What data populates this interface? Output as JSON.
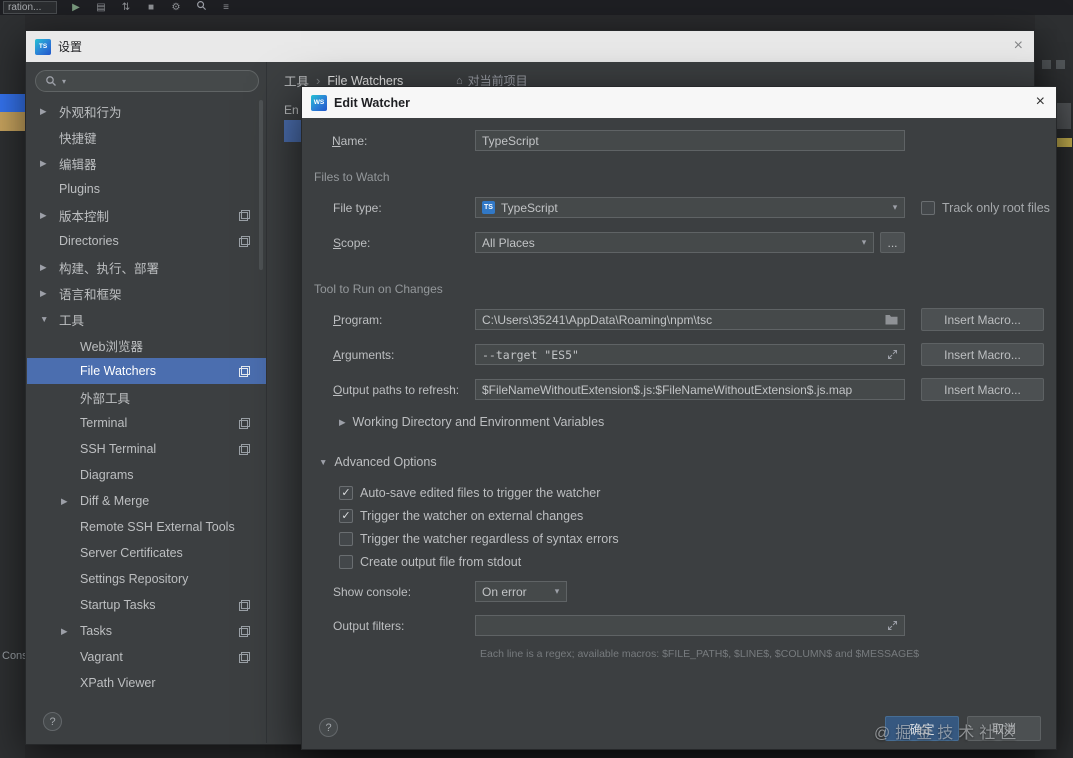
{
  "watermark_text": "@掘金技术社区",
  "colors": {
    "selection_blue": "#4b6eaf",
    "ok_button_blue": "#365880",
    "left_strip_blue": "#3574f0",
    "left_strip_tan": "#c9a55f",
    "right_mark_yellow": "#d4bd55"
  },
  "icons": {
    "close": "×",
    "chevron-right": "▶",
    "chevron-down": "▼",
    "combo-arrow": "▾",
    "check": "✓",
    "help": "?",
    "more": "...",
    "project": "⌂",
    "search-caret": "▾",
    "typescript": "TS",
    "play": "▶",
    "coverage": "▤",
    "sync": "⇅",
    "stop": "■",
    "settings-gear": "⚙",
    "compare": "≡"
  },
  "ide": {
    "run_config_text": "ration...",
    "console_label": "Cons"
  },
  "settings": {
    "title": "设置",
    "search_placeholder": "",
    "breadcrumb": {
      "parent": "工具",
      "sep": "›",
      "current": "File Watchers",
      "scope_note": "对当前项目"
    },
    "partial_table_header": "En",
    "tree": [
      {
        "id": "appearance",
        "label": "外观和行为",
        "level": 0,
        "arrow": "right"
      },
      {
        "id": "keymap",
        "label": "快捷键",
        "level": 0
      },
      {
        "id": "editor",
        "label": "编辑器",
        "level": 0,
        "arrow": "right"
      },
      {
        "id": "plugins",
        "label": "Plugins",
        "level": 0
      },
      {
        "id": "vcs",
        "label": "版本控制",
        "level": 0,
        "arrow": "right",
        "badge": true
      },
      {
        "id": "directories",
        "label": "Directories",
        "level": 0,
        "badge": true
      },
      {
        "id": "build",
        "label": "构建、执行、部署",
        "level": 0,
        "arrow": "right"
      },
      {
        "id": "languages",
        "label": "语言和框架",
        "level": 0,
        "arrow": "right"
      },
      {
        "id": "tools",
        "label": "工具",
        "level": 0,
        "arrow": "down"
      },
      {
        "id": "web-browsers",
        "label": "Web浏览器",
        "level": 1
      },
      {
        "id": "file-watchers",
        "label": "File Watchers",
        "level": 1,
        "selected": true,
        "badge": true
      },
      {
        "id": "external-tools",
        "label": "外部工具",
        "level": 1
      },
      {
        "id": "terminal",
        "label": "Terminal",
        "level": 1,
        "badge": true
      },
      {
        "id": "ssh-terminal",
        "label": "SSH Terminal",
        "level": 1,
        "badge": true
      },
      {
        "id": "diagrams",
        "label": "Diagrams",
        "level": 1
      },
      {
        "id": "diff-merge",
        "label": "Diff & Merge",
        "level": 1,
        "arrow": "right"
      },
      {
        "id": "remote-ssh-external-tools",
        "label": "Remote SSH External Tools",
        "level": 1
      },
      {
        "id": "server-certificates",
        "label": "Server Certificates",
        "level": 1
      },
      {
        "id": "settings-repository",
        "label": "Settings Repository",
        "level": 1
      },
      {
        "id": "startup-tasks",
        "label": "Startup Tasks",
        "level": 1,
        "badge": true
      },
      {
        "id": "tasks",
        "label": "Tasks",
        "level": 1,
        "arrow": "right",
        "badge": true
      },
      {
        "id": "vagrant",
        "label": "Vagrant",
        "level": 1,
        "badge": true
      },
      {
        "id": "xpath-viewer",
        "label": "XPath Viewer",
        "level": 1
      }
    ]
  },
  "watcher": {
    "title": "Edit Watcher",
    "fields": {
      "name": {
        "label": "Name:",
        "value": "TypeScript"
      },
      "files_section": "Files to Watch",
      "file_type": {
        "label": "File type:",
        "value": "TypeScript"
      },
      "track_root": {
        "label": "Track only root files",
        "checked": false
      },
      "scope": {
        "label": "Scope:",
        "value": "All Places"
      },
      "tool_section": "Tool to Run on Changes",
      "program": {
        "label": "Program:",
        "value": "C:\\Users\\35241\\AppData\\Roaming\\npm\\tsc"
      },
      "arguments": {
        "label": "Arguments:",
        "value": "--target \"ES5\""
      },
      "output_paths": {
        "label": "Output paths to refresh:",
        "value": "$FileNameWithoutExtension$.js:$FileNameWithoutExtension$.js.map"
      },
      "insert_macro": "Insert Macro...",
      "working_dir": "Working Directory and Environment Variables",
      "advanced": "Advanced Options",
      "options": [
        {
          "label": "Auto-save edited files to trigger the watcher",
          "checked": true
        },
        {
          "label": "Trigger the watcher on external changes",
          "checked": true
        },
        {
          "label": "Trigger the watcher regardless of syntax errors",
          "checked": false
        },
        {
          "label": "Create output file from stdout",
          "checked": false
        }
      ],
      "show_console": {
        "label": "Show console:",
        "value": "On error"
      },
      "output_filters": {
        "label": "Output filters:",
        "value": "",
        "hint": "Each line is a regex; available macros: $FILE_PATH$, $LINE$, $COLUMN$ and $MESSAGE$"
      }
    },
    "buttons": {
      "ok": "确定",
      "cancel": "取消"
    }
  }
}
